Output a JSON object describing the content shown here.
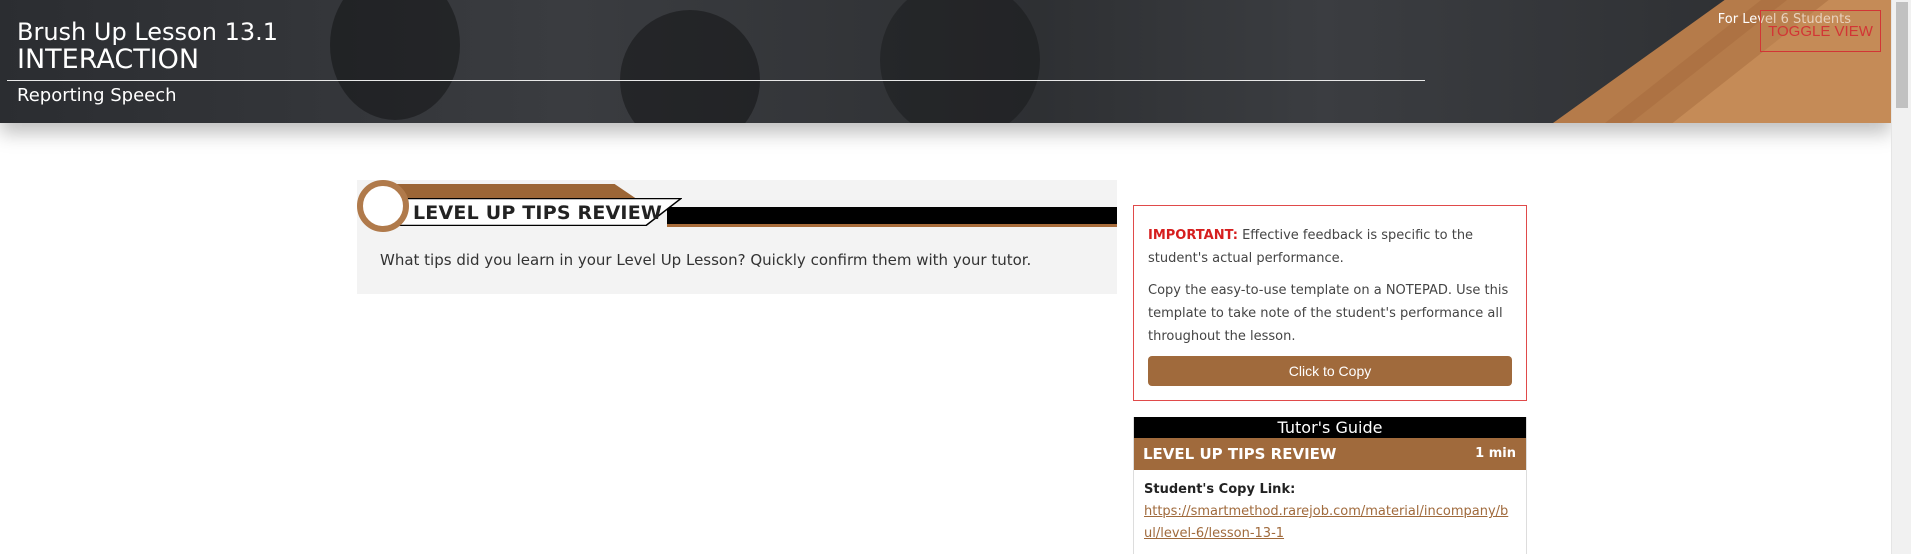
{
  "header": {
    "lesson_title": "Brush Up Lesson 13.1",
    "lesson_type": "INTERACTION",
    "lesson_topic": "Reporting Speech",
    "level_text": "For Level 6 Students",
    "toggle_label": "TOGGLE VIEW"
  },
  "section": {
    "title": "LEVEL UP TIPS REVIEW",
    "question": "What tips did you learn in your Level Up Lesson? Quickly confirm them with your tutor."
  },
  "important": {
    "label": "IMPORTANT:",
    "text1": " Effective feedback is specific to the student's actual performance.",
    "text2": "Copy the easy-to-use template on a NOTEPAD. Use this template to take note of the student's performance all throughout the lesson.",
    "button_label": "Click to Copy"
  },
  "guide": {
    "heading": "Tutor's Guide",
    "section_title": "LEVEL UP TIPS REVIEW",
    "duration": "1 min",
    "link_label": "Student's Copy Link:",
    "link_url": "https://smartmethod.rarejob.com/material/incompany/bul/level-6/lesson-13-1"
  },
  "colors": {
    "accent_brown": "#a06a3c",
    "important_red": "#d61e1e",
    "banner_dark": "#2e3033"
  }
}
